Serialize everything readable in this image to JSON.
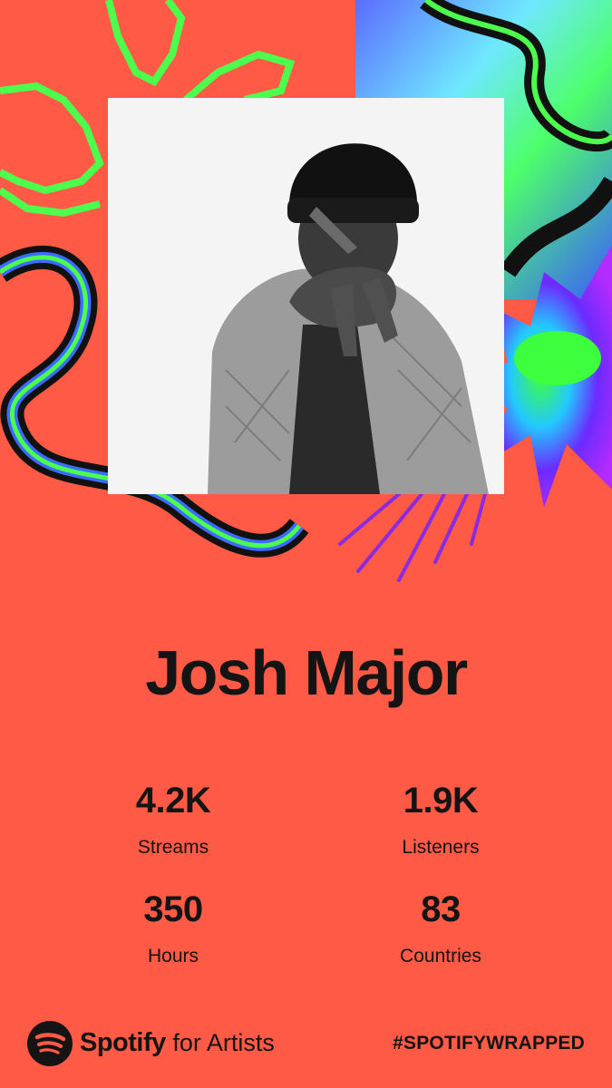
{
  "artist": {
    "name": "Josh Major"
  },
  "stats": [
    {
      "value": "4.2K",
      "label": "Streams"
    },
    {
      "value": "1.9K",
      "label": "Listeners"
    },
    {
      "value": "350",
      "label": "Hours"
    },
    {
      "value": "83",
      "label": "Countries"
    }
  ],
  "footer": {
    "brand": "Spotify",
    "brand_suffix": "for Artists",
    "logo_icon": "spotify-logo-icon",
    "hashtag": "#SPOTIFYWRAPPED"
  },
  "colors": {
    "background": "#ff5a45",
    "text": "#141414",
    "accent_green": "#4dff4d",
    "accent_purple": "#8a2be2",
    "accent_blue": "#5b6cff"
  }
}
